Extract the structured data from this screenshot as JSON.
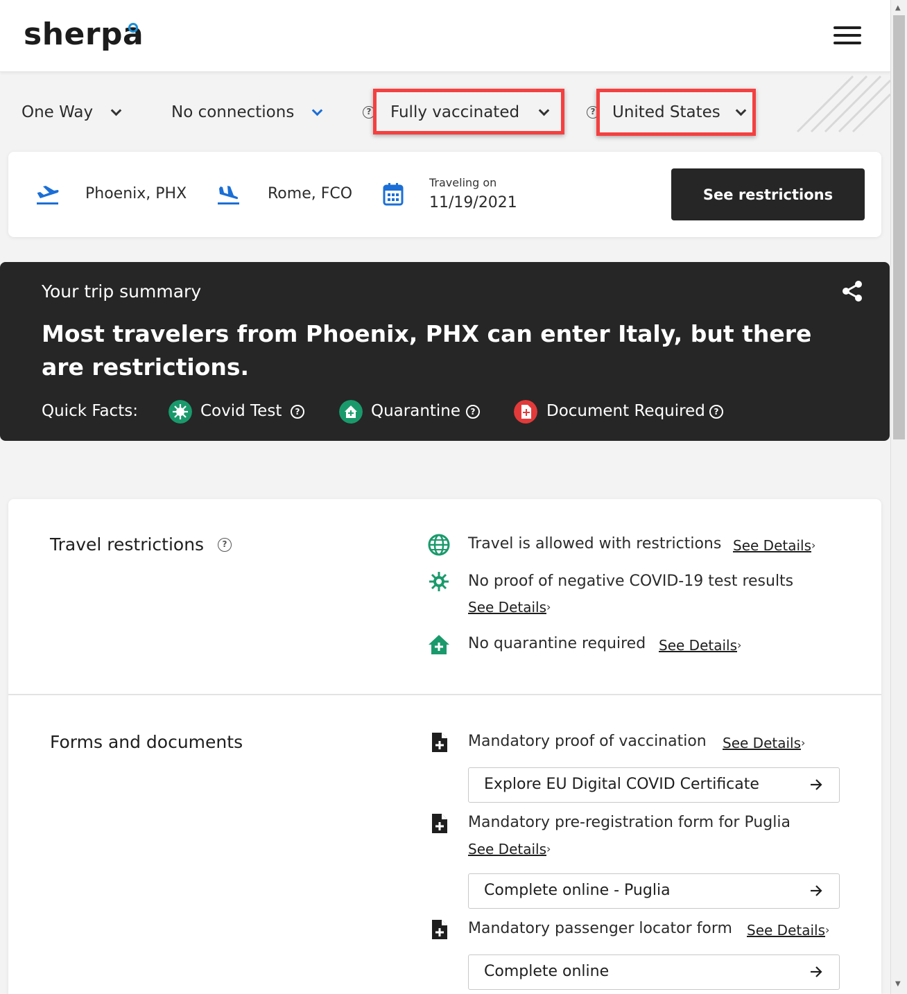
{
  "header": {
    "logo": "sherpa",
    "menu_icon": "hamburger-menu-icon"
  },
  "filters": {
    "trip_type": "One Way",
    "connections": "No connections",
    "vaccination": "Fully vaccinated",
    "nationality": "United States"
  },
  "search": {
    "origin": "Phoenix, PHX",
    "destination": "Rome, FCO",
    "date_label": "Traveling on",
    "date": "11/19/2021",
    "button": "See restrictions"
  },
  "summary": {
    "title": "Your trip summary",
    "headline": "Most travelers from Phoenix, PHX can enter Italy, but there are restrictions.",
    "quick_facts_label": "Quick Facts:",
    "facts": [
      {
        "label": "Covid Test",
        "color": "#1a9a6c"
      },
      {
        "label": "Quarantine",
        "color": "#1a9a6c"
      },
      {
        "label": "Document Required",
        "color": "#e23a3a"
      }
    ]
  },
  "travel_restrictions": {
    "title": "Travel restrictions",
    "items": [
      {
        "text": "Travel is allowed with restrictions",
        "link": "See Details",
        "icon": "globe-icon"
      },
      {
        "text": "No proof of negative COVID-19 test results",
        "link": "See Details",
        "icon": "virus-icon"
      },
      {
        "text": "No quarantine required",
        "link": "See Details",
        "icon": "house-plus-icon"
      }
    ]
  },
  "forms": {
    "title": "Forms and documents",
    "items": [
      {
        "text": "Mandatory proof of vaccination",
        "link": "See Details",
        "action": "Explore EU Digital COVID Certificate"
      },
      {
        "text": "Mandatory pre-registration form for Puglia",
        "link": "See Details",
        "action": "Complete online - Puglia"
      },
      {
        "text": "Mandatory passenger locator form",
        "link": "See Details",
        "action": "Complete online"
      }
    ]
  },
  "colors": {
    "accent_blue": "#1b6fd6",
    "green": "#1a9a6c",
    "red": "#e23a3a",
    "dark": "#262626",
    "highlight": "#f44040"
  }
}
